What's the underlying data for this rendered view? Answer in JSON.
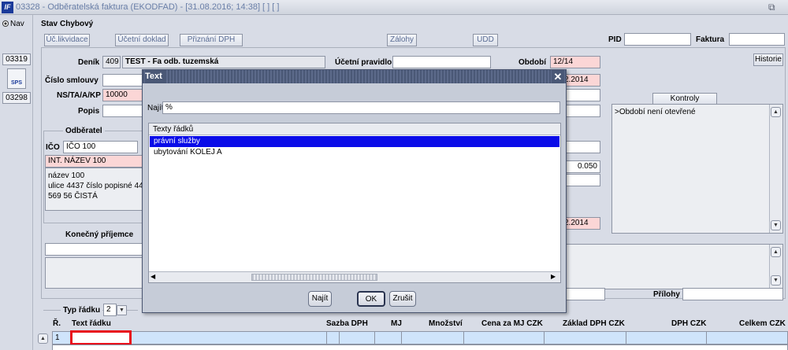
{
  "window": {
    "title": "03328 - Odběratelská faktura (EKODFAD) - [31.08.2016; 14:38] [ ] [ ]",
    "app_icon_text": "IF"
  },
  "icons": {
    "app": "app-icon",
    "restore": "restore-icon",
    "close": "close-icon",
    "sps": "sps-icon",
    "scroll_up": "arrow-up-icon",
    "scroll_down": "arrow-down-icon",
    "dropdown": "chevron-down-icon"
  },
  "left": {
    "nav_label": "Nav",
    "buttons": [
      "03319",
      "03298"
    ],
    "sps_label": "SPS"
  },
  "header": {
    "status_label": "Stav",
    "status_value": "Chybový",
    "buttons": [
      "Úč.likvidace",
      "Účetní doklad",
      "Přiznání DPH",
      "Zálohy",
      "UDD"
    ],
    "pid_label": "PID",
    "pid_value": "",
    "faktura_label": "Faktura",
    "faktura_value": "",
    "historie_label": "Historie"
  },
  "form": {
    "denik_label": "Deník",
    "denik_value": "409",
    "denik_name": "TEST - Fa odb. tuzemská",
    "ucetni_pravidlo_label": "Účetní pravidlo",
    "ucetni_pravidlo_value": "",
    "obdobi_label": "Období",
    "obdobi_value": "12/14",
    "cislo_smlouvy_label": "Číslo smlouvy",
    "cislo_smlouvy_value": "",
    "date_partial_1": "2.2014",
    "nstaakp_label": "NS/TA/A/KP",
    "nstaakp_value": "10000",
    "popis_label": "Popis",
    "popis_value": "",
    "kontroly_label": "Kontroly",
    "kontroly_text": ">Období není otevřené",
    "odberatel_label": "Odběratel",
    "ico_label": "IČO",
    "ico_value": "IČO 100",
    "int_nazev": "INT. NÁZEV 100",
    "address_lines": [
      "název 100",
      "ulice 4437 číslo popisné 4437",
      "569 56 ČISTÁ"
    ],
    "rate_value": "0.050",
    "date_partial_2": "2.2014",
    "konecny_prijemce_label": "Konečný příjemce",
    "prilohy_label": "Přílohy",
    "prilohy_value": ""
  },
  "grid": {
    "typ_radku_label": "Typ řádku",
    "typ_radku_value": "2",
    "columns": [
      "Ř.",
      "Text řádku",
      "Sazba DPH",
      "MJ",
      "Množství",
      "Cena za MJ CZK",
      "Základ DPH CZK",
      "DPH CZK",
      "Celkem CZK"
    ],
    "rows": [
      {
        "num": "1",
        "text": ""
      }
    ]
  },
  "dialog": {
    "title": "Text",
    "najit_label": "Najít",
    "search_value": "%",
    "list_header": "Texty řádků",
    "items": [
      "právní služby",
      "ubytování KOLEJ A"
    ],
    "selected_index": 0,
    "buttons": {
      "find": "Najít",
      "ok": "OK",
      "cancel": "Zrušit"
    }
  }
}
